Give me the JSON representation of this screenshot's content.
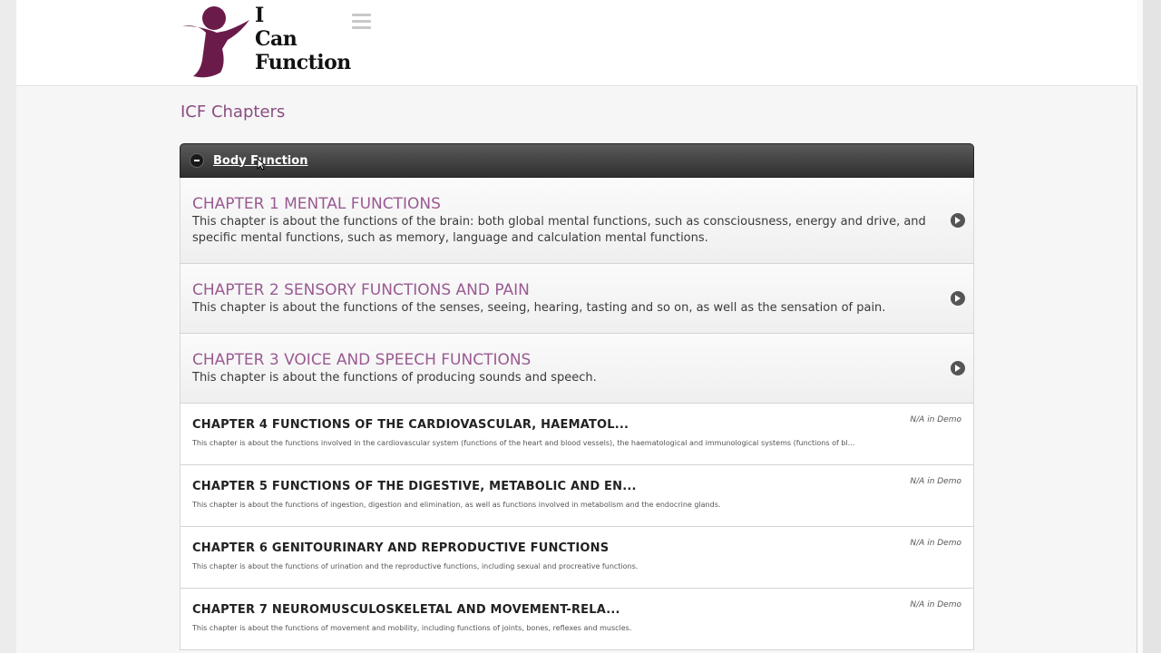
{
  "logo": {
    "line1": "I",
    "line2": "Can",
    "line3": "Function"
  },
  "page_title": "ICF Chapters",
  "panel": {
    "title": "Body Function"
  },
  "chapters_main": [
    {
      "title": "CHAPTER 1 MENTAL FUNCTIONS",
      "desc": "This chapter is about the functions of the brain: both global mental functions, such as consciousness, energy and drive, and specific mental functions, such as memory, language and calculation mental functions."
    },
    {
      "title": "CHAPTER 2 SENSORY FUNCTIONS AND PAIN",
      "desc": "This chapter is about the functions of the senses, seeing, hearing, tasting and so on, as well as the sensation of pain."
    },
    {
      "title": "CHAPTER 3 VOICE AND SPEECH FUNCTIONS",
      "desc": "This chapter is about the functions of producing sounds and speech."
    }
  ],
  "chapters_demo": [
    {
      "title": "CHAPTER 4 FUNCTIONS OF THE CARDIOVASCULAR, HAEMATOL...",
      "desc": "This chapter is about the functions involved in the cardiovascular system (functions of the heart and blood vessels), the haematological and immunological systems (functions of bl...",
      "badge": "N/A in Demo"
    },
    {
      "title": "CHAPTER 5 FUNCTIONS OF THE DIGESTIVE, METABOLIC AND EN...",
      "desc": "This chapter is about the functions of ingestion, digestion and elimination, as well as functions involved in metabolism and the endocrine glands.",
      "badge": "N/A in Demo"
    },
    {
      "title": "CHAPTER 6 GENITOURINARY AND REPRODUCTIVE FUNCTIONS",
      "desc": "This chapter is about the functions of urination and the reproductive functions, including sexual and procreative functions.",
      "badge": "N/A in Demo"
    },
    {
      "title": "CHAPTER 7 NEUROMUSCULOSKELETAL AND MOVEMENT-RELA...",
      "desc": "This chapter is about the functions of movement and mobility, including functions of joints, bones, reflexes and muscles.",
      "badge": "N/A in Demo"
    }
  ],
  "colors": {
    "brand": "#6b1b4a",
    "title_accent": "#9a5a92"
  }
}
